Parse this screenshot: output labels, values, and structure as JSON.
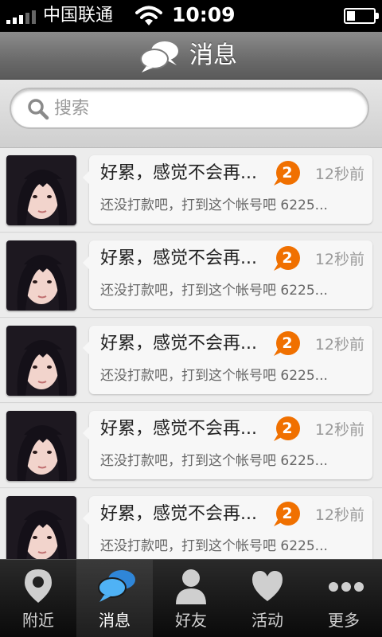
{
  "status_bar": {
    "carrier": "中国联通",
    "time": "10:09",
    "battery_level": 0.3
  },
  "header": {
    "title": "消息",
    "icon": "chat-bubbles-icon"
  },
  "search": {
    "placeholder": "搜索",
    "value": ""
  },
  "messages": [
    {
      "title": "好累，感觉不会再...",
      "badge": "2",
      "time": "12秒前",
      "preview": "还没打款吧，打到这个帐号吧 6225..."
    },
    {
      "title": "好累，感觉不会再...",
      "badge": "2",
      "time": "12秒前",
      "preview": "还没打款吧，打到这个帐号吧 6225..."
    },
    {
      "title": "好累，感觉不会再...",
      "badge": "2",
      "time": "12秒前",
      "preview": "还没打款吧，打到这个帐号吧 6225..."
    },
    {
      "title": "好累，感觉不会再...",
      "badge": "2",
      "time": "12秒前",
      "preview": "还没打款吧，打到这个帐号吧 6225..."
    },
    {
      "title": "好累，感觉不会再...",
      "badge": "2",
      "time": "12秒前",
      "preview": "还没打款吧，打到这个帐号吧 6225..."
    }
  ],
  "tabs": [
    {
      "label": "附近",
      "icon": "location-pin-icon",
      "active": false
    },
    {
      "label": "消息",
      "icon": "chat-bubbles-icon",
      "active": true
    },
    {
      "label": "好友",
      "icon": "person-icon",
      "active": false
    },
    {
      "label": "活动",
      "icon": "heart-icon",
      "active": false
    },
    {
      "label": "更多",
      "icon": "more-dots-icon",
      "active": false
    }
  ],
  "colors": {
    "badge": "#f07000",
    "active_tab_icon": "#3aa0f0"
  }
}
